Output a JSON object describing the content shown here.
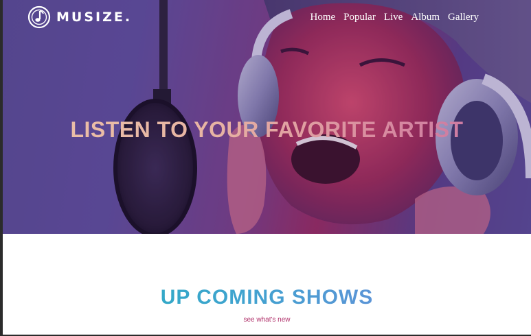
{
  "brand": {
    "name": "MUSIZE.",
    "logo_icon": "music-note-circle-icon"
  },
  "nav": {
    "items": [
      {
        "label": "Home"
      },
      {
        "label": "Popular"
      },
      {
        "label": "Live"
      },
      {
        "label": "Album"
      },
      {
        "label": "Gallery"
      }
    ]
  },
  "hero": {
    "title": "LISTEN TO YOUR FAVORITE ARTIST",
    "image": "singer-with-headphones-at-microphone"
  },
  "shows": {
    "title": "UP COMING SHOWS",
    "subtitle": "see what's new"
  },
  "colors": {
    "hero_overlay": "#5a4c94",
    "hero_title_gradient_start": "#ecc3a9",
    "hero_title_gradient_end": "#c46fa3",
    "shows_title_gradient_start": "#1fb3b9",
    "shows_title_gradient_end": "#7d83e0",
    "subtitle": "#b0306a",
    "nav_text": "#ffffff"
  }
}
